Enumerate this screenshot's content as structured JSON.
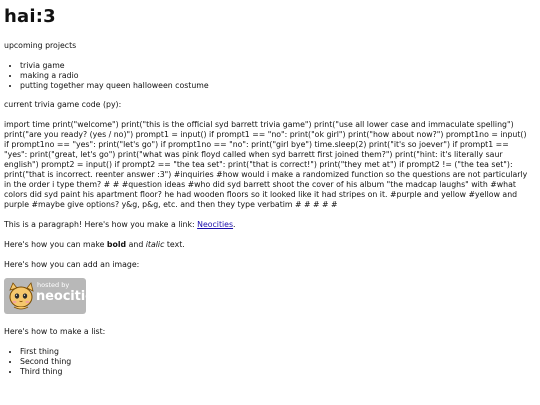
{
  "page": {
    "title": "hai:3",
    "upcoming_heading": "upcoming projects",
    "projects": [
      "trivia game",
      "making a radio",
      "putting together may queen halloween costume"
    ],
    "code_heading": "current trivia game code (py):",
    "code_text": "import time print(\"welcome\") print(\"this is the official syd barrett trivia game\") print(\"use all lower case and immaculate spelling\") print(\"are you ready? (yes / no)\") prompt1 = input() if prompt1 == \"no\": print(\"ok girl\") print(\"how about now?\") prompt1no = input() if prompt1no == \"yes\": print(\"let's go\") if prompt1no == \"no\": print(\"girl bye\") time.sleep(2) print(\"it's so joever\") if prompt1 == \"yes\": print(\"great, let's go\") print(\"what was pink floyd called when syd barrett first joined them?\") print(\"hint: it's literally saur english\") prompt2 = input() if prompt2 == \"the tea set\": print(\"that is correct!\") print(\"they met at\") if prompt2 != (\"the tea set\"): print(\"that is incorrect. reenter answer :3\") #inquiries #how would i make a randomized function so the questions are not particularly in the order i type them? # # #question ideas #who did syd barrett shoot the cover of his album \"the madcap laughs\" with #what colors did syd paint his apartment floor? he had wooden floors so it looked like it had stripes on it. #purple and yellow #yellow and purple #maybe give options? y&g, p&g, etc. and then they type verbatim # # # # #",
    "paragraph_prefix": "This is a paragraph! Here's how you make a link: ",
    "link_text": "Neocities",
    "paragraph_suffix": ".",
    "bold_prefix": "Here's how you can make ",
    "bold_text": "bold",
    "bold_middle": " and ",
    "italic_text": "italic",
    "bold_suffix": " text.",
    "image_heading": "Here's how you can add an image:",
    "badge_small": "hosted by",
    "badge_big": "neocities",
    "list_heading": "Here's how to make a list:",
    "list_items": [
      "First thing",
      "Second thing",
      "Third thing"
    ],
    "badge_background": "#b8b8b8",
    "link_color": "#1a0dab"
  }
}
